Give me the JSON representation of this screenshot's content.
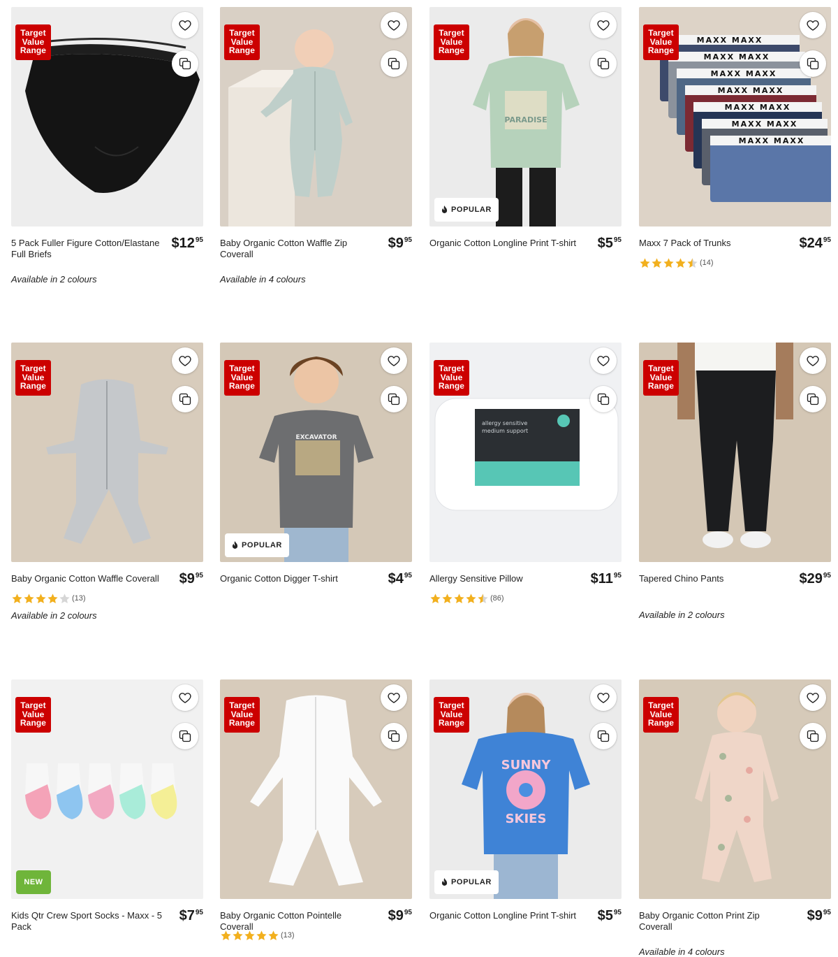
{
  "colors": {
    "target_red": "#cc0000",
    "star_gold": "#f2b01e",
    "new_green": "#6fb53a"
  },
  "badge_text": {
    "target_value_range": [
      "Target",
      "Value",
      "Range"
    ],
    "popular": "POPULAR",
    "new": "NEW"
  },
  "products": [
    {
      "title": "5 Pack Fuller Figure Cotton/Elastane Full Briefs",
      "price_dollars": "$12",
      "price_cents": "95",
      "available": "Available in 2 colours",
      "image": "black-briefs"
    },
    {
      "title": "Baby Organic Cotton Waffle Zip Coverall",
      "price_dollars": "$9",
      "price_cents": "95",
      "available": "Available in 4 colours",
      "image": "baby-waffle-zip"
    },
    {
      "title": "Organic Cotton Longline Print T-shirt",
      "price_dollars": "$5",
      "price_cents": "95",
      "badge": "popular",
      "image": "green-tshirt"
    },
    {
      "title": "Maxx 7 Pack of Trunks",
      "price_dollars": "$24",
      "price_cents": "95",
      "rating": 4.5,
      "review_count": "(14)",
      "image": "trunks-stack"
    },
    {
      "title": "Baby Organic Cotton Waffle Coverall",
      "price_dollars": "$9",
      "price_cents": "95",
      "rating": 4,
      "review_count": "(13)",
      "available": "Available in 2 colours",
      "image": "grey-coverall"
    },
    {
      "title": "Organic Cotton Digger T-shirt",
      "price_dollars": "$4",
      "price_cents": "95",
      "badge": "popular",
      "image": "digger-tshirt"
    },
    {
      "title": "Allergy Sensitive Pillow",
      "price_dollars": "$11",
      "price_cents": "95",
      "rating": 4.5,
      "review_count": "(86)",
      "image": "pillow"
    },
    {
      "title": "Tapered Chino Pants",
      "price_dollars": "$29",
      "price_cents": "95",
      "available": "Available in 2 colours",
      "image": "chino-pants"
    },
    {
      "title": "Kids Qtr Crew Sport Socks - Maxx - 5 Pack",
      "price_dollars": "$7",
      "price_cents": "95",
      "badge": "new",
      "image": "socks"
    },
    {
      "title": "Baby Organic Cotton Pointelle Coverall",
      "price_dollars": "$9",
      "price_cents": "95",
      "rating": 5,
      "review_count": "(13)",
      "image": "white-coverall"
    },
    {
      "title": "Organic Cotton Longline Print T-shirt",
      "price_dollars": "$5",
      "price_cents": "95",
      "badge": "popular",
      "image": "blue-tshirt"
    },
    {
      "title": "Baby Organic Cotton Print Zip Coverall",
      "price_dollars": "$9",
      "price_cents": "95",
      "available": "Available in 4 colours",
      "image": "floral-coverall"
    }
  ],
  "icons": {
    "favourite": "heart-icon",
    "compare": "compare-icon",
    "popular": "flame-icon",
    "rating": "star-icon"
  }
}
